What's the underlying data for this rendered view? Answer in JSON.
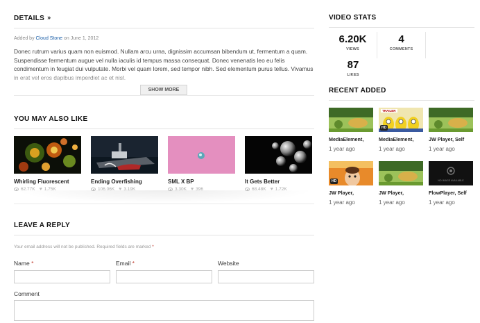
{
  "details": {
    "title": "DETAILS",
    "meta_prefix": "Added by",
    "author": "Cloud Stone",
    "meta_date": "on June 1, 2012",
    "description": "Donec rutrum varius quam non euismod. Nullam arcu urna, dignissim accumsan bibendum ut, fermentum a quam. Suspendisse fermentum augue vel nulla iaculis id tempus massa consequat. Donec venenatis leo eu felis condimentum in feugiat dui vulputate. Morbi vel quam lorem, sed tempor nibh. Sed elementum purus tellus. Vivamus in erat vel eros dapibus imperdiet ac et nisl.",
    "show_more": "SHOW MORE"
  },
  "also_like": {
    "title": "YOU MAY ALSO LIKE",
    "items": [
      {
        "title": "Whirling Fluorescent",
        "views": "62.77K",
        "likes": "1.75K"
      },
      {
        "title": "Ending Overfishing",
        "views": "106.06K",
        "likes": "3.19K"
      },
      {
        "title": "SML X BP",
        "views": "3.30K",
        "likes": "396"
      },
      {
        "title": "It Gets Better",
        "views": "68.48K",
        "likes": "1.72K"
      }
    ]
  },
  "reply": {
    "title": "LEAVE A REPLY",
    "note": "Your email address will not be published. Required fields are marked",
    "required_mark": "*",
    "name_label": "Name",
    "email_label": "Email",
    "website_label": "Website",
    "comment_label": "Comment"
  },
  "video_stats": {
    "title": "VIDEO STATS",
    "views_num": "6.20K",
    "views_label": "VIEWS",
    "comments_num": "4",
    "comments_label": "COMMENTS",
    "likes_num": "87",
    "likes_label": "LIKES"
  },
  "recent": {
    "title": "RECENT ADDED",
    "items": [
      {
        "title": "MediaElement,",
        "time": "1 year ago"
      },
      {
        "title": "MediaElement,",
        "time": "1 year ago"
      },
      {
        "title": "JW Player, Self",
        "time": "1 year ago"
      },
      {
        "title": "JW Player,",
        "time": "1 year ago"
      },
      {
        "title": "JW Player,",
        "time": "1 year ago"
      },
      {
        "title": "FlowPlayer, Self",
        "time": "1 year ago"
      }
    ],
    "badge_hd": "HD",
    "badge_trailer": "TRAILER",
    "no_image_text": "NO IMAGE AVAILABLE"
  }
}
